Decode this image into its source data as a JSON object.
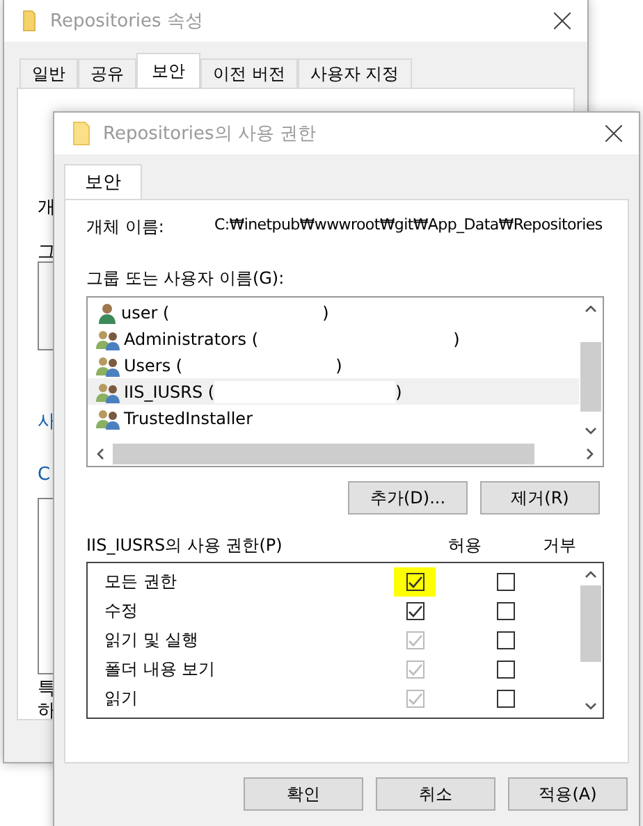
{
  "back_window": {
    "title": "Repositories 속성",
    "tabs": [
      {
        "label": "일반",
        "selected": false
      },
      {
        "label": "공유",
        "selected": false
      },
      {
        "label": "보안",
        "selected": true
      },
      {
        "label": "이전 버전",
        "selected": false
      },
      {
        "label": "사용자 지정",
        "selected": false
      }
    ],
    "visible_fragments": [
      "개",
      "그",
      "사",
      "C",
      "특",
      "하"
    ]
  },
  "window": {
    "title": "Repositories의 사용 권한",
    "tabs": [
      {
        "label": "보안",
        "selected": true
      }
    ],
    "object_name_label": "개체 이름:",
    "object_name": "C:₩inetpub₩wwwroot₩git₩App_Data₩Repositories",
    "group_label": "그룹 또는 사용자 이름(G):",
    "principals": [
      {
        "name": "user (",
        "close": ")",
        "kind": "user",
        "selected": false
      },
      {
        "name": "Administrators (",
        "close": ")",
        "kind": "group",
        "selected": false
      },
      {
        "name": "Users (",
        "close": ")",
        "kind": "group",
        "selected": false
      },
      {
        "name": "IIS_IUSRS (",
        "close": ")",
        "kind": "group",
        "selected": true
      },
      {
        "name": "TrustedInstaller",
        "kind": "group",
        "selected": false
      }
    ],
    "add_button": "추가(D)...",
    "remove_button": "제거(R)",
    "permissions_label": "IIS_IUSRS의 사용 권한(P)",
    "allow_header": "허용",
    "deny_header": "거부",
    "permissions": [
      {
        "name": "모든 권한",
        "allow": true,
        "allow_disabled": false,
        "deny": false,
        "highlighted": true
      },
      {
        "name": "수정",
        "allow": true,
        "allow_disabled": false,
        "deny": false,
        "highlighted": false
      },
      {
        "name": "읽기 및 실행",
        "allow": true,
        "allow_disabled": true,
        "deny": false,
        "highlighted": false
      },
      {
        "name": "폴더 내용 보기",
        "allow": true,
        "allow_disabled": true,
        "deny": false,
        "highlighted": false
      },
      {
        "name": "읽기",
        "allow": true,
        "allow_disabled": true,
        "deny": false,
        "highlighted": false
      }
    ],
    "buttons": [
      "확인",
      "취소",
      "적용(A)"
    ]
  }
}
